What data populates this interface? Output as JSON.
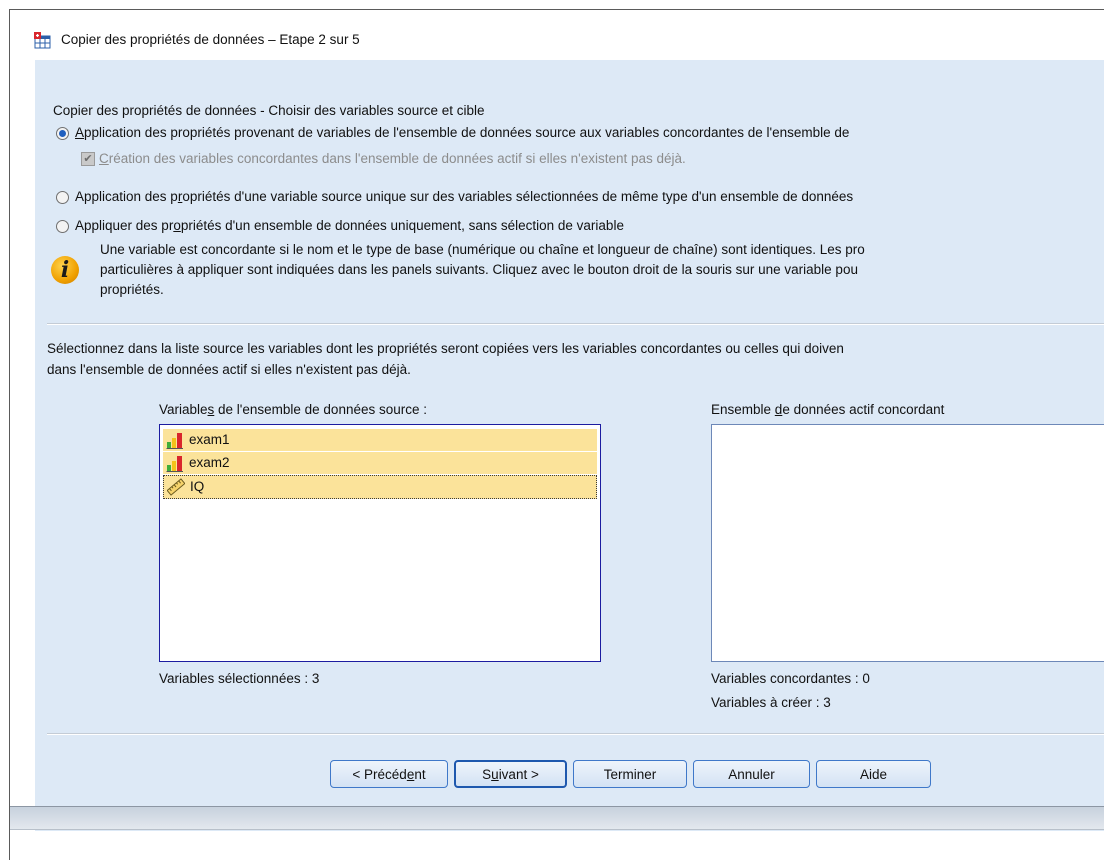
{
  "window": {
    "title": "Copier des propriétés de données – Etape 2 sur 5",
    "icon": "table-copy-icon"
  },
  "heading": "Copier des propriétés de données - Choisir des variables source et cible",
  "options": [
    {
      "label_prefix": "A",
      "label_rest": "pplication des propriétés provenant de variables de l'ensemble de données source aux variables concordantes de l'ensemble de",
      "selected": true
    },
    {
      "label_prefix": "Application des p",
      "label_ul": "r",
      "label_rest": "opriétés d'une variable source unique sur des variables sélectionnées de même type d'un ensemble de données",
      "selected": false
    },
    {
      "label_prefix": "Appliquer des pr",
      "label_ul": "o",
      "label_rest": "priétés d'un ensemble de données uniquement, sans sélection de variable",
      "selected": false
    }
  ],
  "create_checkbox": {
    "label_ul": "C",
    "label_rest": "réation des variables concordantes dans l'ensemble de données actif si elles n'existent pas déjà.",
    "checked": true,
    "enabled": false
  },
  "info": {
    "icon": "info-icon",
    "line1": "Une variable est concordante si le nom et le type de base (numérique ou chaîne et longueur de chaîne) sont identiques. Les pro",
    "line2": "particulières à appliquer sont indiquées dans les panels suivants. Cliquez avec le bouton droit de la souris sur une variable pou",
    "line3": "propriétés."
  },
  "instruction": {
    "line1": "Sélectionnez dans la liste source les variables dont les propriétés seront copiées vers les variables concordantes ou celles qui doiven",
    "line2": "dans l'ensemble de données actif si elles n'existent pas déjà."
  },
  "source_list": {
    "label_prefix": "Variable",
    "label_ul": "s",
    "label_rest": " de l'ensemble de données source :",
    "items": [
      {
        "name": "exam1",
        "icon": "ordinal-bar-icon"
      },
      {
        "name": "exam2",
        "icon": "ordinal-bar-icon"
      },
      {
        "name": "IQ",
        "icon": "scale-ruler-icon"
      }
    ],
    "count_text": "Variables sélectionnées : 3"
  },
  "target_list": {
    "label_prefix": "Ensemble ",
    "label_ul": "d",
    "label_rest": "e données actif concordant",
    "items": [],
    "matching_text": "Variables concordantes : 0",
    "to_create_text": "Variables à créer : 3"
  },
  "buttons": {
    "previous": {
      "prefix": "< Précéd",
      "ul": "e",
      "rest": "nt"
    },
    "next": {
      "prefix": "S",
      "ul": "u",
      "rest": "ivant >"
    },
    "finish": "Terminer",
    "cancel": "Annuler",
    "help": "Aide"
  },
  "colors": {
    "dialog_bg": "#dde9f6",
    "list_selection": "#fbe39a",
    "radio_dot": "#1f5fbf",
    "button_border": "#3f78c9"
  }
}
